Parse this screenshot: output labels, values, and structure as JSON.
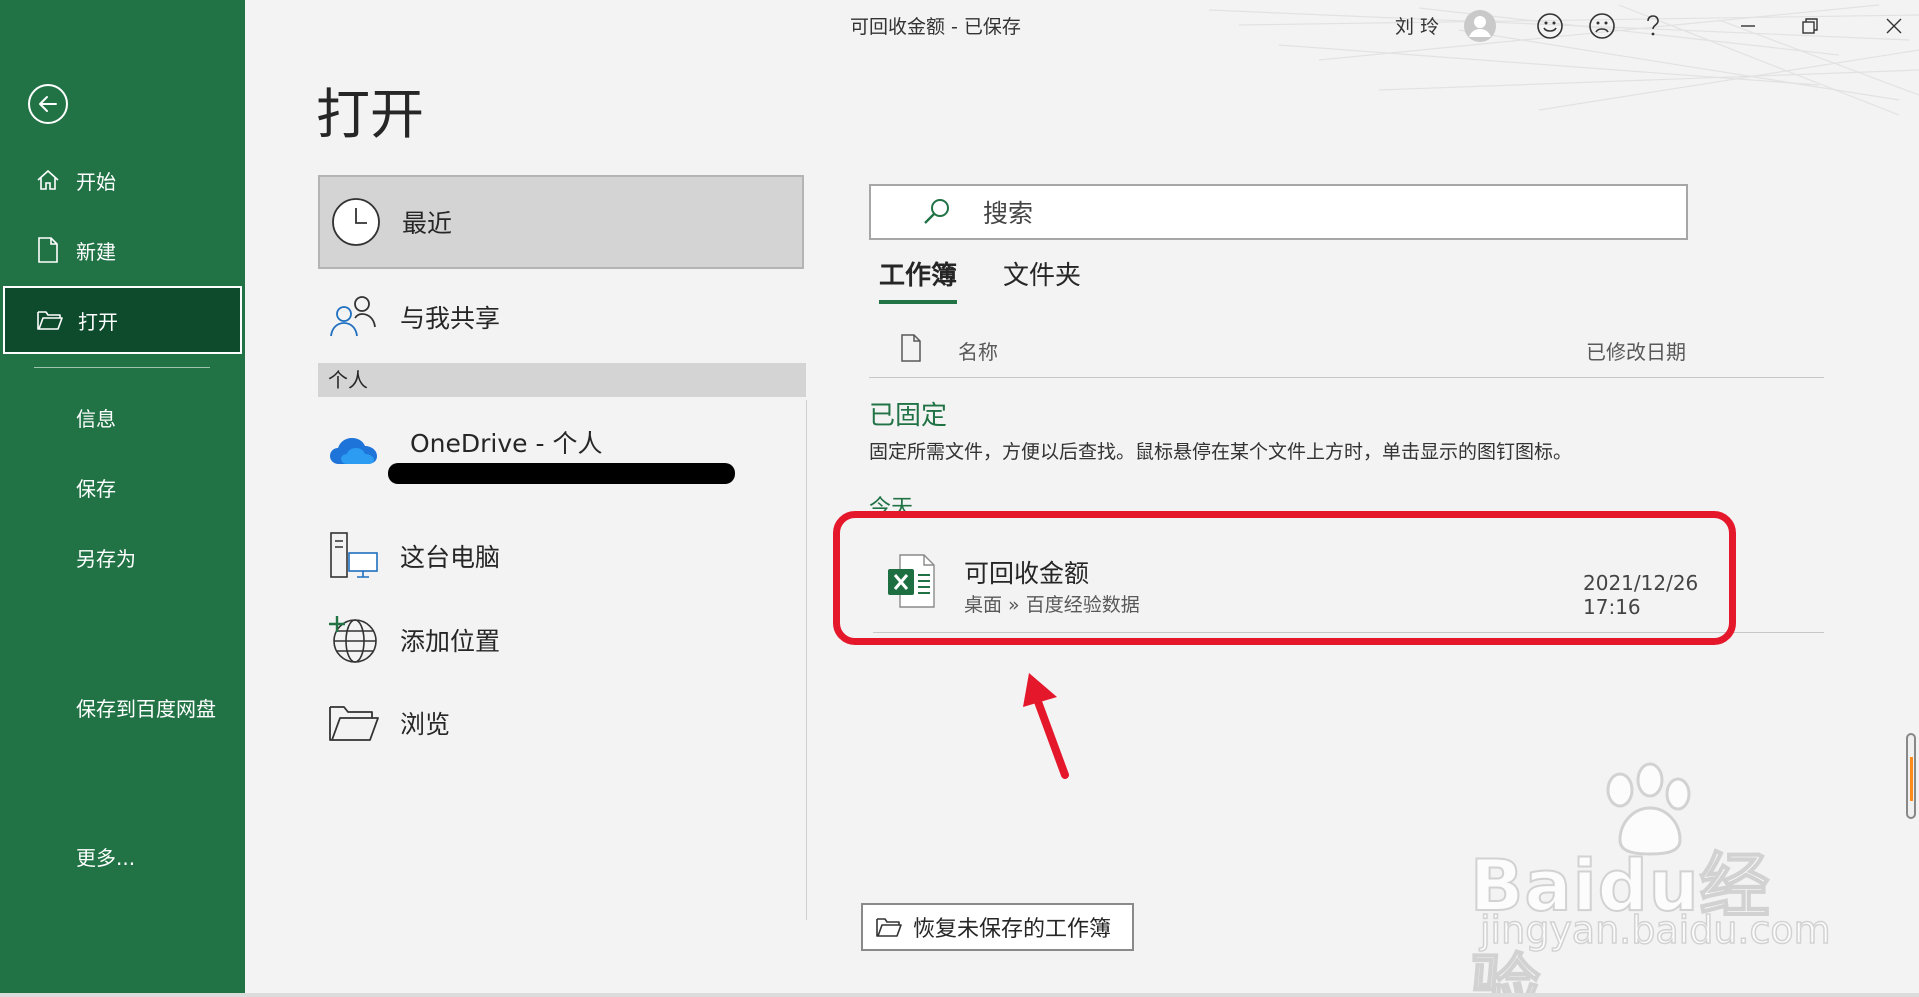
{
  "window": {
    "title": "可回收金额 - 已保存",
    "user_name": "刘 玲"
  },
  "sidebar": {
    "items": [
      {
        "label": "开始",
        "icon": "home-icon"
      },
      {
        "label": "新建",
        "icon": "new-document-icon"
      },
      {
        "label": "打开",
        "icon": "folder-open-icon",
        "active": true
      },
      {
        "label": "信息"
      },
      {
        "label": "保存"
      },
      {
        "label": "另存为"
      },
      {
        "label": "保存到百度网盘"
      },
      {
        "label": "更多..."
      }
    ]
  },
  "page_title": "打开",
  "locations": {
    "recent": "最近",
    "shared": "与我共享",
    "section_personal": "个人",
    "onedrive": "OneDrive - 个人",
    "this_pc": "这台电脑",
    "add_place": "添加位置",
    "browse": "浏览"
  },
  "search": {
    "placeholder": "搜索"
  },
  "tabs": {
    "workbooks": "工作簿",
    "folders": "文件夹"
  },
  "columns": {
    "name": "名称",
    "modified": "已修改日期"
  },
  "pinned": {
    "title": "已固定",
    "description": "固定所需文件，方便以后查找。鼠标悬停在某个文件上方时，单击显示的图钉图标。"
  },
  "today_label": "今天",
  "files": [
    {
      "name": "可回收金额",
      "path": "桌面 » 百度经验数据",
      "modified": "2021/12/26 17:16",
      "icon": "excel-file-icon"
    }
  ],
  "recover_button": "恢复未保存的工作簿",
  "watermark": {
    "main": "Baidu经验",
    "sub": "jingyan.baidu.com"
  },
  "colors": {
    "excel_green": "#217346",
    "sidebar_active": "#0e4a2c",
    "highlight_red": "#e5172b"
  }
}
